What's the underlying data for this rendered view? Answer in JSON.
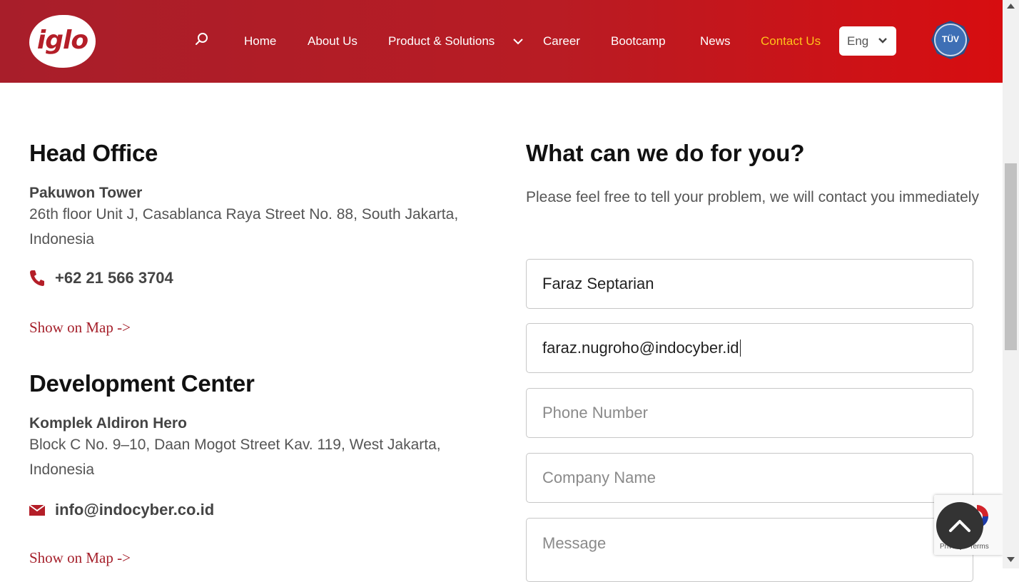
{
  "header": {
    "logo_text": "iglo",
    "nav": [
      {
        "label": "Home"
      },
      {
        "label": "About Us"
      },
      {
        "label": "Product & Solutions"
      },
      {
        "label": "Career"
      },
      {
        "label": "Bootcamp"
      },
      {
        "label": "News"
      },
      {
        "label": "Contact Us",
        "active": true
      }
    ],
    "language": "Eng",
    "certification_badge": "TÜV",
    "colors": {
      "gradient_start": "#a81e2a",
      "gradient_end": "#d70d10",
      "active_link": "#ffc21a"
    }
  },
  "offices": {
    "head": {
      "title": "Head Office",
      "name": "Pakuwon Tower",
      "address": "26th floor Unit J, Casablanca Raya Street No. 88, South Jakarta, Indonesia",
      "phone": "+62 21 566 3704",
      "map_link": "Show on Map ->",
      "icon": "phone-icon"
    },
    "dev": {
      "title": "Development Center",
      "name": "Komplek Aldiron Hero",
      "address": "Block C No. 9–10, Daan Mogot Street Kav. 119, West Jakarta, Indonesia",
      "email": "info@indocyber.co.id",
      "map_link": "Show on Map ->",
      "icon": "mail-icon"
    }
  },
  "form": {
    "title": "What can we do for you?",
    "subtitle": "Please feel free to tell your problem, we will contact you immediately",
    "name_value": "Faraz Septarian",
    "email_value": "faraz.nugroho@indocyber.id",
    "phone_placeholder": "Phone Number",
    "company_placeholder": "Company Name",
    "message_placeholder": "Message"
  },
  "recaptcha": {
    "terms_text": "Privacy - Terms"
  }
}
